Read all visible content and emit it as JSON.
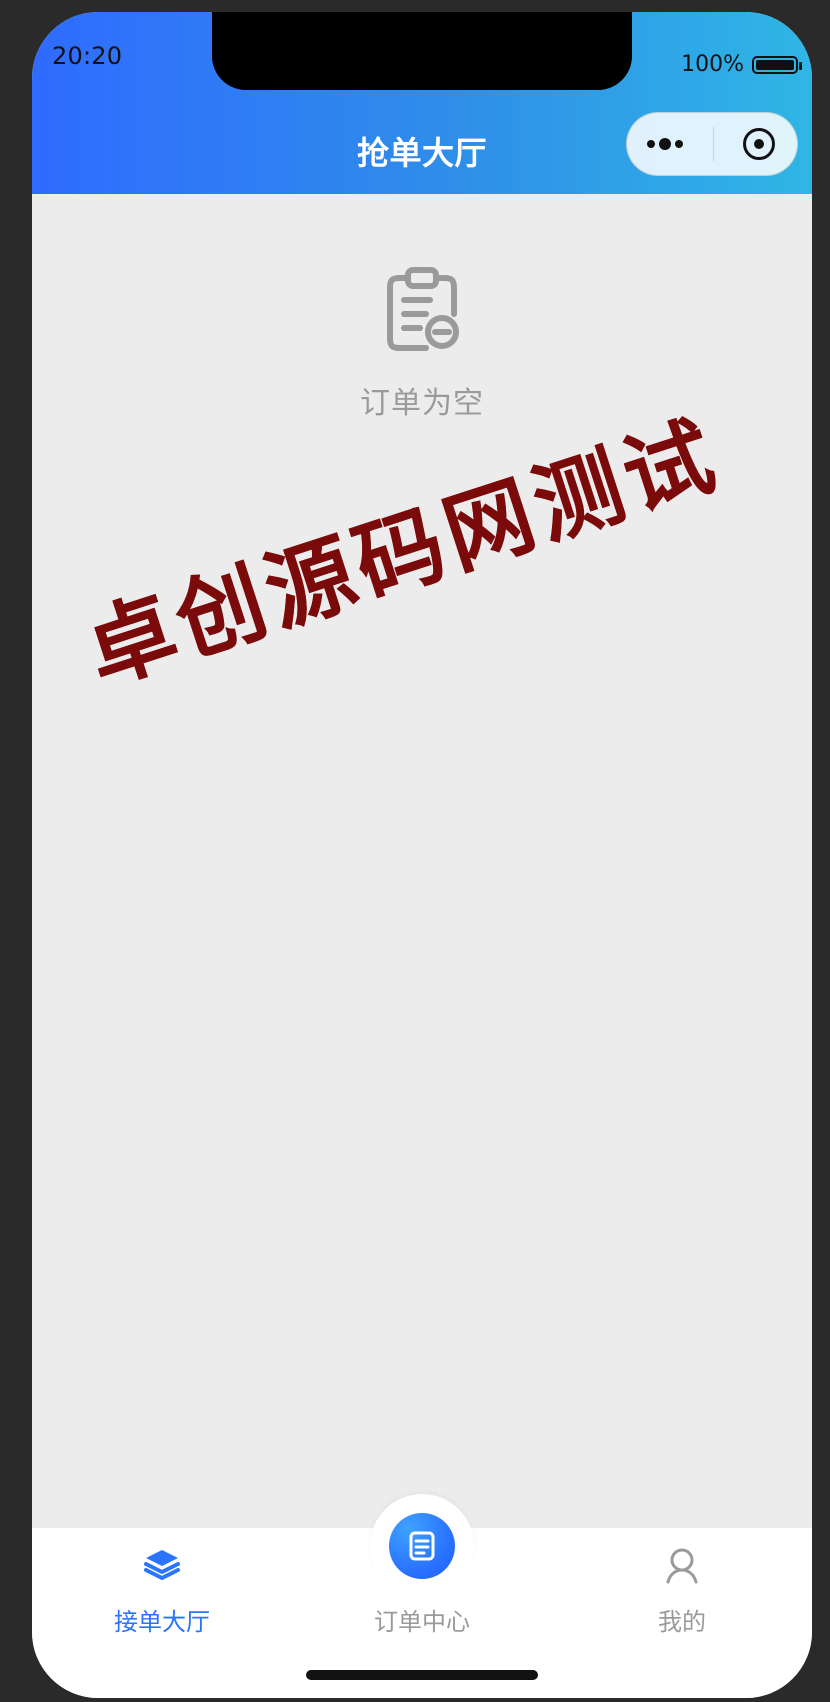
{
  "status_bar": {
    "time": "20:20",
    "battery_percent_text": "100%"
  },
  "header": {
    "title": "抢单大厅",
    "capsule": {
      "more_icon": "more-dots-icon",
      "target_icon": "target-icon"
    },
    "gradient_colors": [
      "#2f6bff",
      "#2fb6e6"
    ]
  },
  "main": {
    "empty_state": {
      "icon": "clipboard-minus-icon",
      "text": "订单为空"
    }
  },
  "watermark": {
    "text": "卓创源码网测试",
    "color": "#7b0b0b"
  },
  "tabbar": {
    "items": [
      {
        "label": "接单大厅",
        "icon": "layers-icon",
        "active": true
      },
      {
        "label": "订单中心",
        "icon": "document-icon",
        "active": false
      },
      {
        "label": "我的",
        "icon": "user-icon",
        "active": false
      }
    ],
    "active_color": "#2a74ff",
    "inactive_color": "#9a9a9a"
  }
}
